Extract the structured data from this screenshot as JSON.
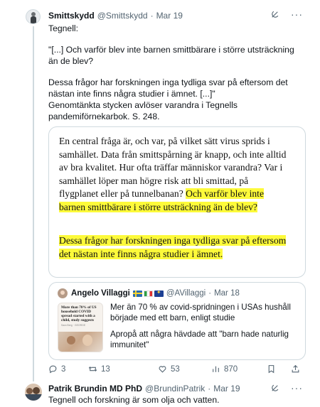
{
  "tweet": {
    "name": "Smittskydd",
    "handle": "@Smittskydd",
    "separator": "·",
    "date": "Mar 19",
    "lines": [
      "Tegnell:",
      "\"[...] Och varför blev inte barnen smittbärare i större utsträckning än de blev?",
      "Dessa frågor har forskningen inga tydliga svar på eftersom det nästan inte finns några studier i ämnet. [...]\"",
      "Genomtänkta stycken avlöser varandra i Tegnells pandemiförnekarbok. S. 248."
    ],
    "excerpt": {
      "plain": "En central fråga är, och var, på vilket sätt virus sprids i samhället. Data från smittspårning är knapp, och inte alltid av bra kvalitet. Hur ofta träffar människor varandra? Var i samhället löper man högre risk att bli smittad, på flygplanet eller på tunnelbanan? ",
      "highlight": "Och varför blev inte barnen smittbärare i större utsträckning än de blev?",
      "highlight2": "Dessa frågor har forskningen inga tydliga svar på eftersom det nästan inte finns några studier i ämnet."
    },
    "quote": {
      "name": "Angelo Villaggi",
      "handle": "@AVillaggi",
      "date": "Mar 18",
      "thumb_headline": "More than 70% of US household COVID spread started with a child, study suggests",
      "thumb_byline": "Sara Berg · GEORGE",
      "text1": "Mer än 70 % av covid-spridningen i USAs hushåll började med ett barn, enligt studie",
      "text2": "Apropå att några hävdade att \"barn hade naturlig immunitet\""
    },
    "actions": {
      "replies": "3",
      "retweets": "13",
      "likes": "53",
      "views": "870"
    }
  },
  "reply": {
    "name": "Patrik Brundin MD PhD",
    "handle": "@BrundinPatrik",
    "separator": "·",
    "date": "Mar 19",
    "text": "Tegnell och forskning är som olja och vatten."
  },
  "icons": {
    "more": "more-icon",
    "grok": "grok-icon",
    "reply": "reply-icon",
    "retweet": "retweet-icon",
    "like": "heart-icon",
    "views": "views-icon",
    "bookmark": "bookmark-icon",
    "share": "share-icon"
  },
  "colors": {
    "highlight": "#fdfa3a",
    "secondary_text": "#536471",
    "border": "#cfd9de"
  }
}
